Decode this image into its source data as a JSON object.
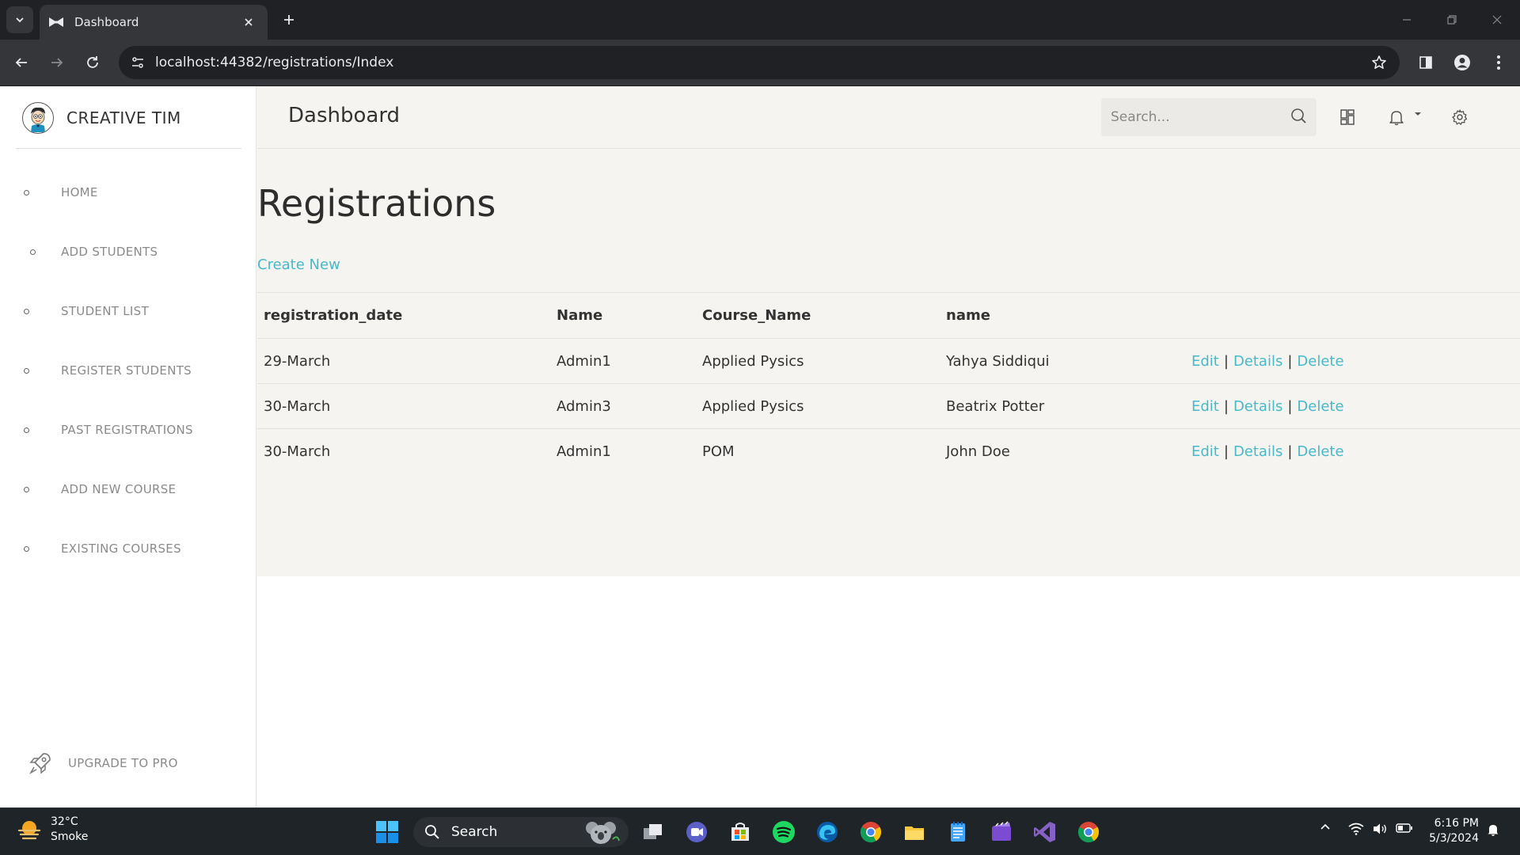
{
  "browser": {
    "tab_title": "Dashboard",
    "url": "localhost:44382/registrations/Index"
  },
  "sidebar": {
    "brand": "CREATIVE TIM",
    "items": [
      {
        "label": "HOME"
      },
      {
        "label": "ADD STUDENTS"
      },
      {
        "label": "STUDENT LIST"
      },
      {
        "label": "REGISTER STUDENTS"
      },
      {
        "label": "PAST REGISTRATIONS"
      },
      {
        "label": "ADD NEW COURSE"
      },
      {
        "label": "EXISTING COURSES"
      }
    ],
    "upgrade": "UPGRADE TO PRO"
  },
  "topbar": {
    "title": "Dashboard",
    "search_placeholder": "Search..."
  },
  "page": {
    "heading": "Registrations",
    "create_new": "Create New"
  },
  "table": {
    "headers": [
      "registration_date",
      "Name",
      "Course_Name",
      "name"
    ],
    "rows": [
      {
        "date": "29-March",
        "name": "Admin1",
        "course": "Applied Pysics",
        "student": "Yahya Siddiqui"
      },
      {
        "date": "30-March",
        "name": "Admin3",
        "course": "Applied Pysics",
        "student": "Beatrix Potter"
      },
      {
        "date": "30-March",
        "name": "Admin1",
        "course": "POM",
        "student": "John Doe"
      }
    ],
    "actions": {
      "edit": "Edit",
      "details": "Details",
      "delete": "Delete",
      "separator": "|"
    }
  },
  "taskbar": {
    "temperature": "32°C",
    "condition": "Smoke",
    "search_label": "Search",
    "time": "6:16 PM",
    "date": "5/3/2024"
  },
  "colors": {
    "accent": "#48b9c7",
    "browser_dark": "#202124",
    "taskbar": "#1f2428"
  }
}
